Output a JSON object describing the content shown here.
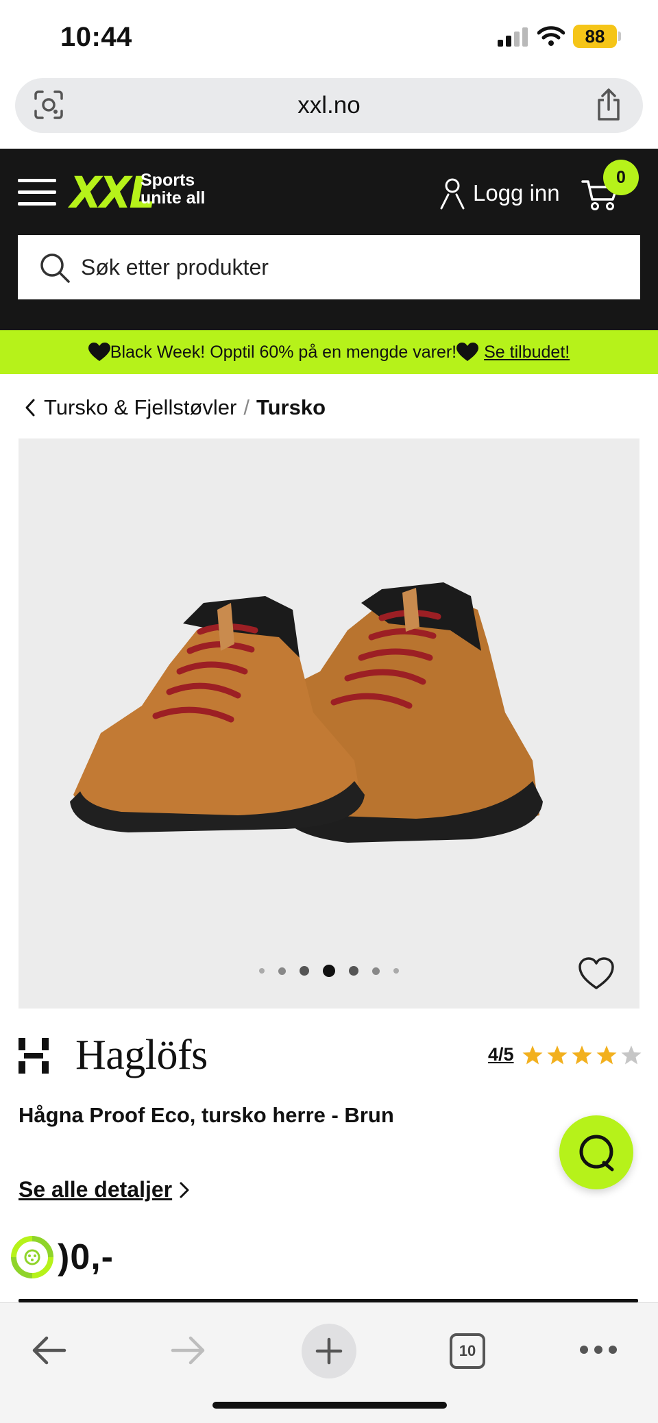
{
  "status_bar": {
    "time": "10:44",
    "battery": "88"
  },
  "browser": {
    "url": "xxl.no",
    "tab_count": "10"
  },
  "header": {
    "logo": "XXL",
    "tagline_line1": "Sports",
    "tagline_line2": "unite all",
    "login_label": "Logg inn",
    "cart_count": "0",
    "search_placeholder": "Søk etter produkter"
  },
  "promo": {
    "text": "Black Week! Opptil 60% på en mengde varer!",
    "link": "Se tilbudet!"
  },
  "breadcrumb": {
    "parent": "Tursko & Fjellstøvler",
    "separator": "/",
    "current": "Tursko"
  },
  "product": {
    "brand": "Haglöfs",
    "rating_text": "4/5",
    "rating_value": 4,
    "rating_max": 5,
    "title": "Hågna Proof Eco, tursko herre - Brun",
    "details_link": "Se alle detaljer",
    "price_visible": ")0,-",
    "gallery_dots": 7,
    "gallery_active_index": 3
  },
  "colors": {
    "brand_green": "#b6f21a",
    "header_bg": "#161616",
    "star_fill": "#f2b01e",
    "star_empty": "#c6c6c6"
  },
  "icons": [
    "camera-lens-icon",
    "share-icon",
    "menu-icon",
    "user-icon",
    "cart-icon",
    "search-icon",
    "heart-icon",
    "chevron-left-icon",
    "chevron-right-icon",
    "chat-icon",
    "back-arrow-icon",
    "forward-arrow-icon",
    "plus-icon",
    "more-icon"
  ]
}
